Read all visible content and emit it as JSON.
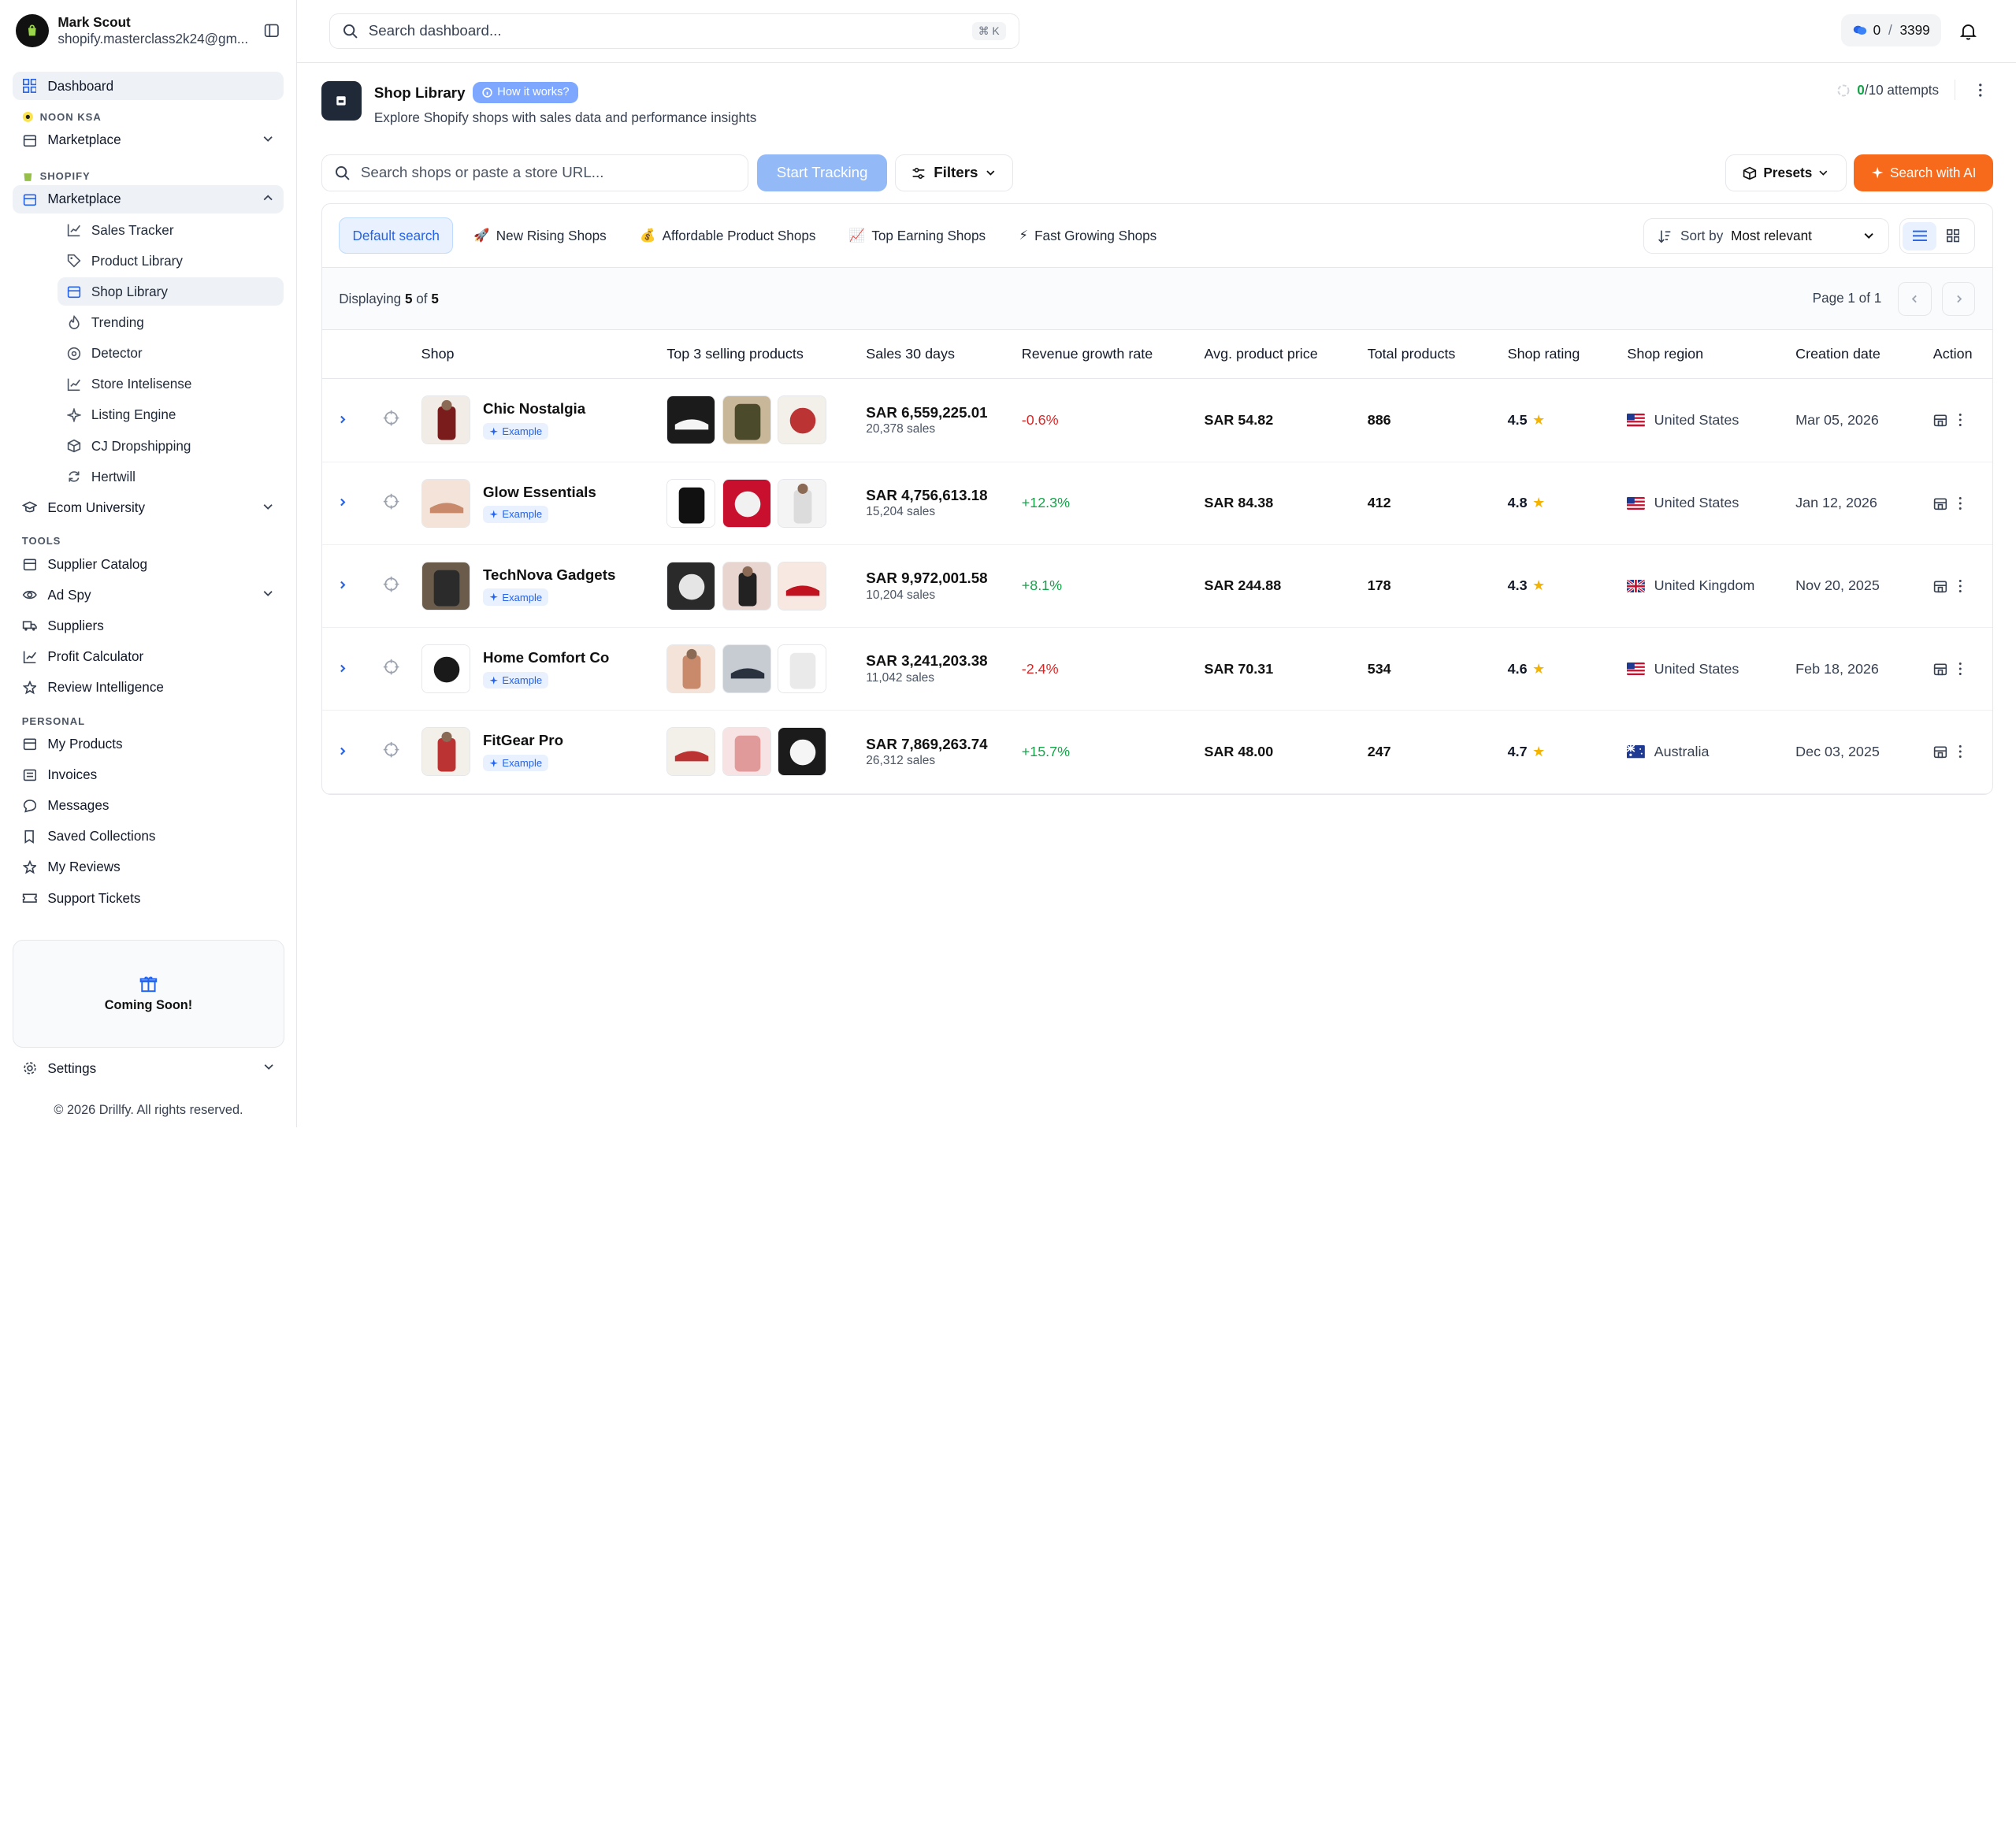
{
  "sidebar": {
    "profile": {
      "name": "Mark Scout",
      "email": "shopify.masterclass2k24@gm...",
      "avatar_text": "Shopify"
    },
    "dashboard_label": "Dashboard",
    "noon_label": "NOON KSA",
    "noon_marketplace": "Marketplace",
    "shopify_label": "SHOPIFY",
    "shopify_marketplace": "Marketplace",
    "sub_items": [
      {
        "label": "Sales Tracker",
        "icon": "chart-line-icon"
      },
      {
        "label": "Product Library",
        "icon": "tag-icon"
      },
      {
        "label": "Shop Library",
        "icon": "store-icon"
      },
      {
        "label": "Trending",
        "icon": "flame-icon"
      },
      {
        "label": "Detector",
        "icon": "radar-icon"
      },
      {
        "label": "Store Intelisense",
        "icon": "chart-line-icon"
      },
      {
        "label": "Listing Engine",
        "icon": "sparkle-icon"
      },
      {
        "label": "CJ Dropshipping",
        "icon": "package-icon"
      },
      {
        "label": "Hertwill",
        "icon": "refresh-icon"
      }
    ],
    "ecom_university": "Ecom University",
    "tools_label": "TOOLS",
    "tools": [
      "Supplier Catalog",
      "Ad Spy",
      "Suppliers",
      "Profit Calculator",
      "Review Intelligence"
    ],
    "personal_label": "PERSONAL",
    "personal": [
      "My Products",
      "Invoices",
      "Messages",
      "Saved Collections",
      "My Reviews",
      "Support Tickets"
    ],
    "coming_soon": "Coming Soon!",
    "settings": "Settings",
    "copyright": "© 2026 Drillfy. All rights reserved."
  },
  "topbar": {
    "search_placeholder": "Search dashboard...",
    "shortcut": "⌘ K",
    "credits_used": "0",
    "credits_sep": "/",
    "credits_total": "3399"
  },
  "page": {
    "title": "Shop Library",
    "how_badge": "How it works?",
    "subtitle": "Explore Shopify shops with sales data and performance insights",
    "attempts_used": "0",
    "attempts_rest": "/10 attempts"
  },
  "toolbar": {
    "search_placeholder": "Search shops or paste a store URL...",
    "start_tracking": "Start Tracking",
    "filters": "Filters",
    "presets": "Presets",
    "search_ai": "Search with AI"
  },
  "tabs": [
    {
      "label": "Default search",
      "emoji": ""
    },
    {
      "label": "New Rising Shops",
      "emoji": "🚀"
    },
    {
      "label": "Affordable Product Shops",
      "emoji": "💰"
    },
    {
      "label": "Top Earning Shops",
      "emoji": "📈"
    },
    {
      "label": "Fast Growing Shops",
      "emoji": "⚡"
    }
  ],
  "sort": {
    "label": "Sort by",
    "value": "Most relevant"
  },
  "listing": {
    "displaying": "Displaying",
    "shown": "5",
    "of": "of",
    "total": "5",
    "page_info": "Page 1 of 1"
  },
  "table": {
    "headers": [
      "Shop",
      "Top 3 selling products",
      "Sales 30 days",
      "Revenue growth rate",
      "Avg. product price",
      "Total products",
      "Shop rating",
      "Shop region",
      "Creation date",
      "Action"
    ],
    "example_label": "Example",
    "rows": [
      {
        "shop": "Chic Nostalgia",
        "sales": "SAR 6,559,225.01",
        "sales_count": "20,378 sales",
        "growth": "-0.6%",
        "growth_dir": "neg",
        "price": "SAR 54.82",
        "products": "886",
        "rating": "4.5",
        "region": "United States",
        "flag": "us",
        "date": "Mar 05, 2026"
      },
      {
        "shop": "Glow Essentials",
        "sales": "SAR 4,756,613.18",
        "sales_count": "15,204 sales",
        "growth": "+12.3%",
        "growth_dir": "pos",
        "price": "SAR 84.38",
        "products": "412",
        "rating": "4.8",
        "region": "United States",
        "flag": "us",
        "date": "Jan 12, 2026"
      },
      {
        "shop": "TechNova Gadgets",
        "sales": "SAR 9,972,001.58",
        "sales_count": "10,204 sales",
        "growth": "+8.1%",
        "growth_dir": "pos",
        "price": "SAR 244.88",
        "products": "178",
        "rating": "4.3",
        "region": "United Kingdom",
        "flag": "uk",
        "date": "Nov 20, 2025"
      },
      {
        "shop": "Home Comfort Co",
        "sales": "SAR 3,241,203.38",
        "sales_count": "11,042 sales",
        "growth": "-2.4%",
        "growth_dir": "neg",
        "price": "SAR 70.31",
        "products": "534",
        "rating": "4.6",
        "region": "United States",
        "flag": "us",
        "date": "Feb 18, 2026"
      },
      {
        "shop": "FitGear Pro",
        "sales": "SAR 7,869,263.74",
        "sales_count": "26,312 sales",
        "growth": "+15.7%",
        "growth_dir": "pos",
        "price": "SAR 48.00",
        "products": "247",
        "rating": "4.7",
        "region": "Australia",
        "flag": "au",
        "date": "Dec 03, 2025"
      }
    ]
  },
  "colors": {
    "accent": "#2563eb",
    "ai_button": "#f76a1c",
    "track_button": "#93b9f7",
    "positive": "#16a34a",
    "negative": "#dc2626"
  }
}
